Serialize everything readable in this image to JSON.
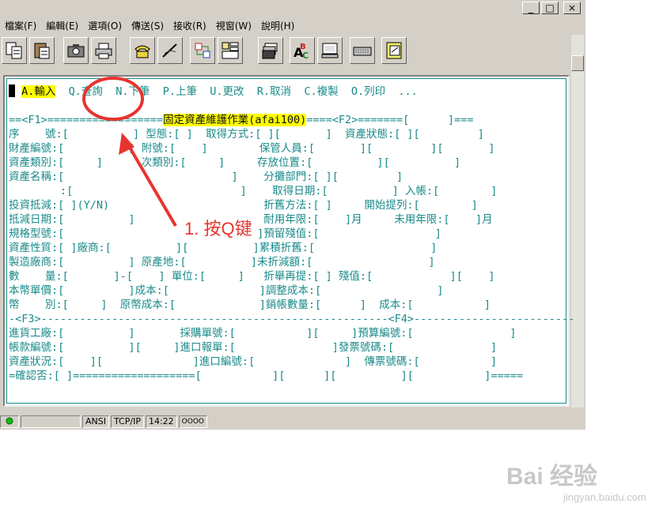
{
  "window": {
    "controls": {
      "minimize": "_",
      "maximize": "□",
      "close": "×"
    }
  },
  "menubar": [
    "檔案(F)",
    "編輯(E)",
    "選項(O)",
    "傳送(S)",
    "接收(R)",
    "視窗(W)",
    "說明(H)"
  ],
  "toolbar": {
    "icons": [
      "copy-icon",
      "paste-icon",
      "camera-icon",
      "printer-icon",
      "phone-icon",
      "hangup-icon",
      "transfer-icon",
      "layout-icon",
      "stack-icon",
      "spellcheck-icon",
      "monitor-icon",
      "keyboard-icon",
      "notepad-icon"
    ]
  },
  "terminal": {
    "menu_options": [
      {
        "label": "A.輸入",
        "highlighted": true
      },
      {
        "label": "Q.查詢",
        "highlighted": false
      },
      {
        "label": "N.下筆",
        "highlighted": false
      },
      {
        "label": "P.上筆",
        "highlighted": false
      },
      {
        "label": "U.更改",
        "highlighted": false
      },
      {
        "label": "R.取消",
        "highlighted": false
      },
      {
        "label": "C.複製",
        "highlighted": false
      },
      {
        "label": "O.列印",
        "highlighted": false
      },
      {
        "label": "...",
        "highlighted": false
      }
    ],
    "title_left": "==<F1>==================",
    "title": "固定資產維護作業(afai100)",
    "title_right": "====<F2>=======[      ]===",
    "lines": [
      "序    號:[          ] 型態:[ ]  取得方式:[ ][       ]  資產狀態:[ ][         ]",
      "財產編號:[          ] 附號:[    ]        保管人員:[       ][         ][       ]",
      "資產類別:[     ]      次類別:[     ]     存放位置:[          ][          ]",
      "資產名稱:[                          ]    分攤部門:[ ][         ]",
      "        :[                          ]    取得日期:[          ] 入帳:[        ]",
      "投資抵減:[ ](Y/N)                        折舊方法:[ ]     開始提列:[        ]",
      "抵減日期:[          ]                    耐用年限:[    ]月     未用年限:[    ]月",
      "規格型號:[                              ]預留殘值:[                  ]",
      "資產性質:[ ]廠商:[          ][          ]累積折舊:[                  ]",
      "製造廠商:[          ] 原產地:[          ]未折減額:[                  ]",
      "數    量:[       ]-[    ] 單位:[     ]   折舉再提:[ ] 殘值:[            ][    ]",
      "本幣單價:[          ]成本:[              ]調整成本:[                  ]",
      "幣    別:[     ]  原幣成本:[             ]銷帳數量:[      ]  成本:[           ]"
    ],
    "f3_line": "-<F3>------------------------------------------------------<F4>-------------------------",
    "lines2": [
      "進貨工廠:[          ]       採購單號:[           ][     ]預算編號:[               ]",
      "帳款編號:[          ][     ]進口報單:[               ]發票號碼:[               ]",
      "資產狀況:[    ][              ]進口編號:[              ]  傳票號碼:[           ]",
      "=確認否:[ ]===================[           ][      ][          ][           ]====="
    ]
  },
  "statusbar": {
    "encoding": "ANSI",
    "protocol": "TCP/IP",
    "time": "14:22",
    "indicator": "OOOO"
  },
  "annotation": {
    "text": "1. 按Q键",
    "color": "#e8342e"
  },
  "watermark": {
    "brand": "Bai 经验",
    "site": "jingyan.baidu.com"
  },
  "colors": {
    "terminal_text": "#1a8a8a",
    "highlight": "#ffff00",
    "chrome": "#d4d0c8"
  }
}
